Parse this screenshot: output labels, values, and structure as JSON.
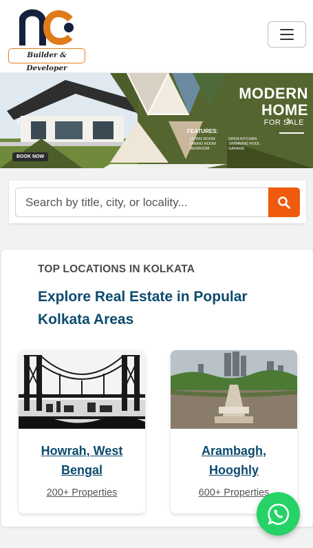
{
  "header": {
    "logo_text": "Builder & Developer",
    "menu_icon": "hamburger-icon"
  },
  "banner": {
    "title_line1": "MODERN",
    "title_line2": "HOME",
    "subtitle": "FOR SALE",
    "features_title": "FEATURES:",
    "features_left": [
      "LIVING ROOM",
      "DINING ROOM",
      "BEDROOM"
    ],
    "features_right": [
      "OPEN KITCHEN",
      "SWIMMING POOL",
      "GARAGE"
    ],
    "cta": "BOOK NOW",
    "prev_icon": "chevron-left-icon",
    "next_icon": "chevron-right-icon"
  },
  "search": {
    "placeholder": "Search by title, city, or locality...",
    "button_icon": "search-icon"
  },
  "locations": {
    "eyebrow": "TOP LOCATIONS IN KOLKATA",
    "heading": "Explore Real Estate in Popular Kolkata Areas",
    "cards": [
      {
        "name": "Howrah, West Bengal",
        "count": "200+ Properties",
        "image": "howrah-bridge-illustration"
      },
      {
        "name": "Arambagh, Hooghly",
        "count": "600+ Properties",
        "image": "arambagh-aerial-photo"
      }
    ]
  },
  "whatsapp": {
    "icon": "whatsapp-icon"
  },
  "colors": {
    "accent": "#f05a0e",
    "heading": "#0c4a6e",
    "banner_green": "#55652f",
    "whatsapp": "#25d366",
    "logo_orange": "#e07b1a",
    "logo_navy": "#14213d"
  }
}
